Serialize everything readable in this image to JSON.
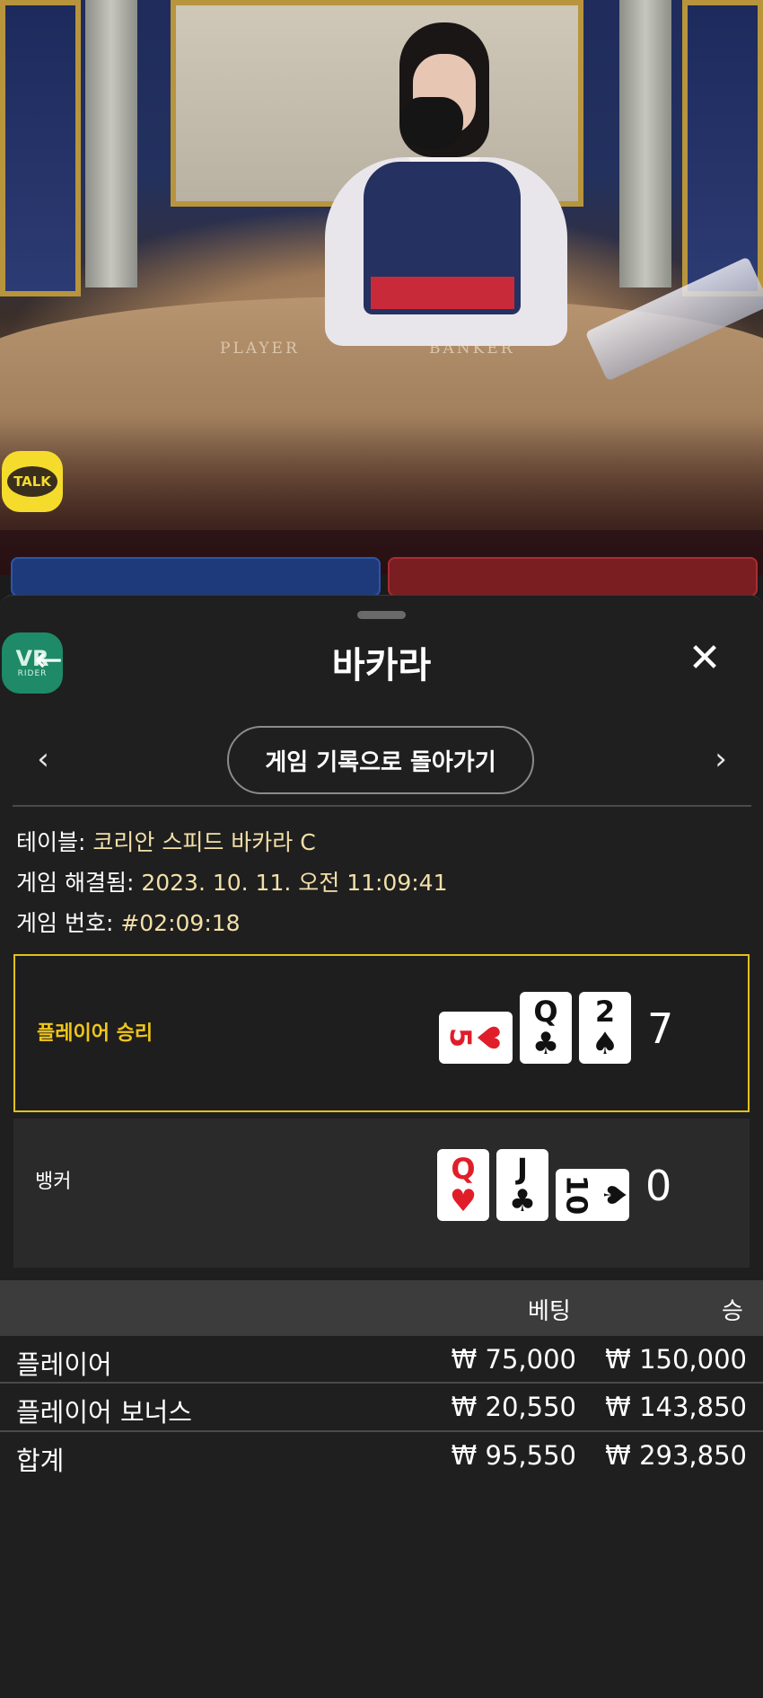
{
  "video": {
    "felt_player": "PLAYER",
    "felt_banker": "BANKER",
    "talk_label": "TALK"
  },
  "sheet": {
    "title": "바카라",
    "back_icon": "arrow-left-icon",
    "close_icon": "close-icon",
    "vr_badge": {
      "top": "VR",
      "bottom": "RIDER"
    },
    "nav": {
      "prev_icon": "chevron-left-icon",
      "next_icon": "chevron-right-icon",
      "back_to_history_label": "게임 기록으로 돌아가기"
    },
    "info": {
      "table_label": "테이블: ",
      "table_value": "코리안 스피드 바카라 C",
      "resolved_label": "게임 해결됨: ",
      "resolved_value": "2023. 10. 11. 오전 11:09:41",
      "game_no_label": "게임 번호: ",
      "game_no_value": "#02:09:18"
    },
    "player": {
      "label": "플레이어 승리",
      "cards": [
        {
          "rank": "5",
          "suit": "♥",
          "color": "red",
          "side": true
        },
        {
          "rank": "Q",
          "suit": "♣",
          "color": "black",
          "side": false
        },
        {
          "rank": "2",
          "suit": "♠",
          "color": "black",
          "side": false
        }
      ],
      "total": "7"
    },
    "banker": {
      "label": "뱅커",
      "cards": [
        {
          "rank": "Q",
          "suit": "♥",
          "color": "red",
          "side": false
        },
        {
          "rank": "J",
          "suit": "♣",
          "color": "black",
          "side": false
        },
        {
          "rank": "10",
          "suit": "♠",
          "color": "black",
          "side": true
        }
      ],
      "total": "0"
    },
    "bets": {
      "header": {
        "bet": "베팅",
        "win": "승"
      },
      "rows": [
        {
          "name": "플레이어",
          "bet": "₩ 75,000",
          "win": "₩ 150,000"
        },
        {
          "name": "플레이어 보너스",
          "bet": "₩ 20,550",
          "win": "₩ 143,850"
        },
        {
          "name": "합계",
          "bet": "₩ 95,550",
          "win": "₩ 293,850"
        }
      ]
    }
  },
  "colors": {
    "accent_gold": "#e2c11c",
    "sheet_bg": "#1f1f1f",
    "bets_header_bg": "#3c3c3c",
    "vr_badge": "#1e8a67",
    "talk_badge": "#f5dc2c"
  }
}
